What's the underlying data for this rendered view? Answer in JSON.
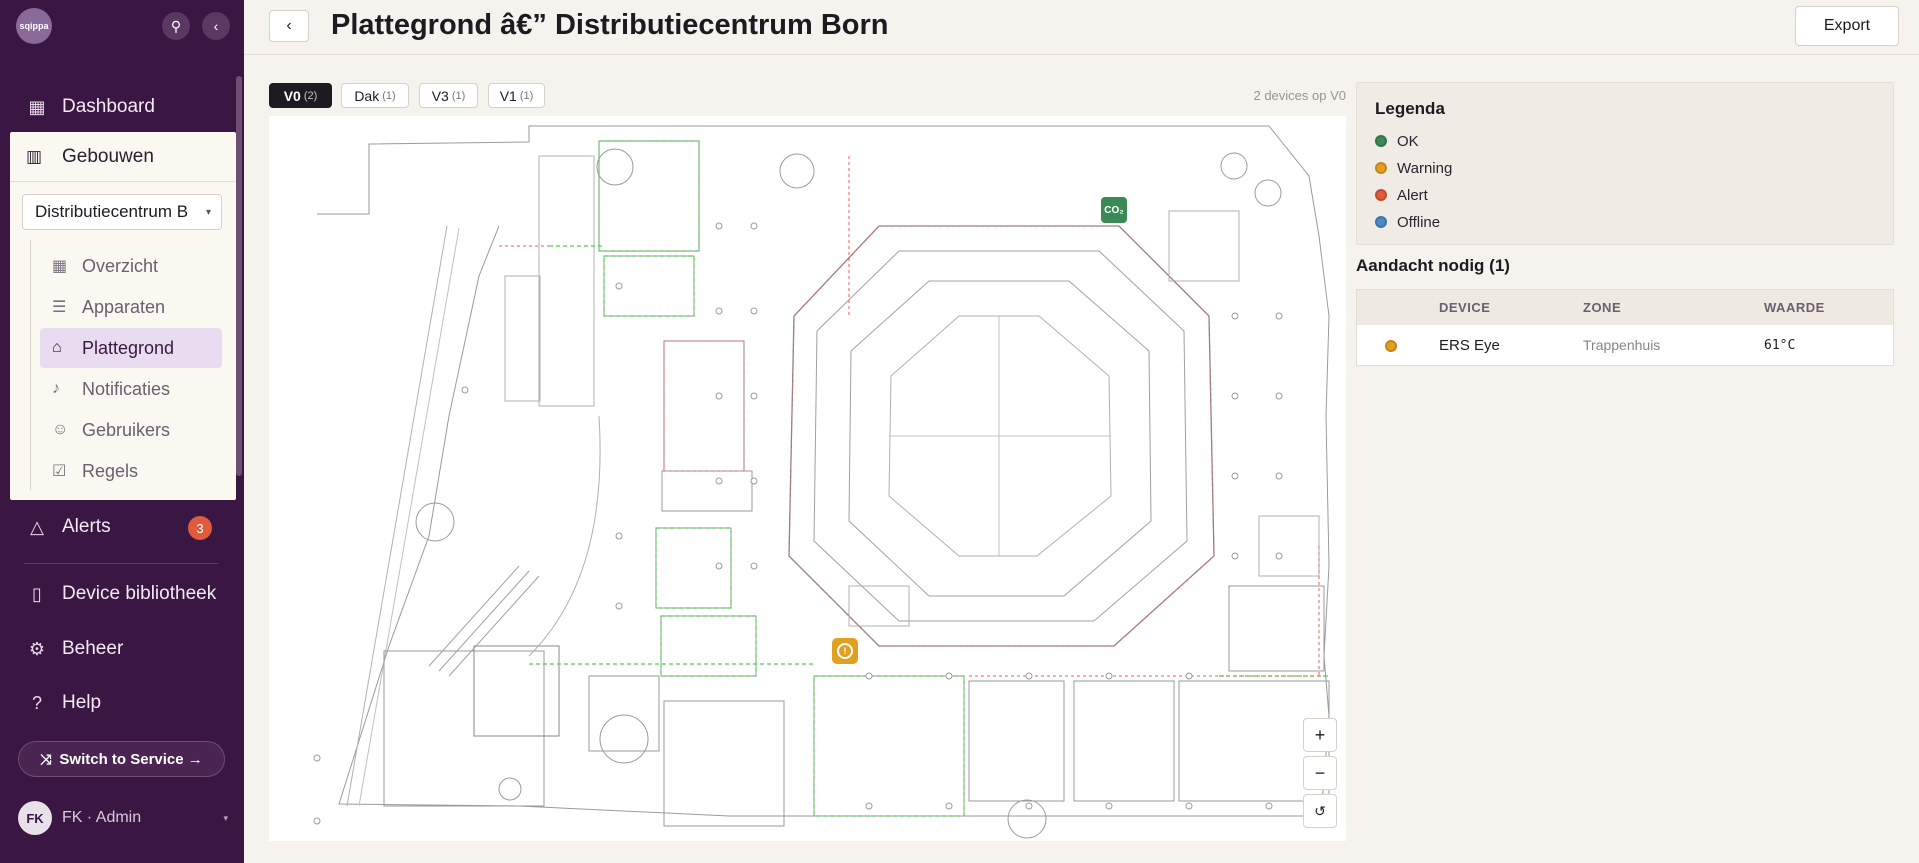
{
  "app": {
    "logo_text": "sqippa"
  },
  "sidebar": {
    "top_buttons": [
      {
        "icon": "pin-icon",
        "glyph": "⚲"
      },
      {
        "icon": "chevron-left-icon",
        "glyph": "‹"
      }
    ],
    "items": [
      {
        "label": "Dashboard",
        "icon": "grid-icon",
        "glyph": "▦"
      },
      {
        "label": "Alerts",
        "icon": "alert-triangle-icon",
        "glyph": "△",
        "badge": "3"
      },
      {
        "label": "Device bibliotheek",
        "icon": "book-icon",
        "glyph": "▯"
      },
      {
        "label": "Beheer",
        "icon": "gear-icon",
        "glyph": "⚙"
      },
      {
        "label": "Help",
        "icon": "help-circle-icon",
        "glyph": "?"
      }
    ],
    "buildings": {
      "label": "Gebouwen",
      "icon": "building-icon",
      "glyph": "▥",
      "selected_building": "Distributiecentrum B",
      "sub_items": [
        {
          "label": "Overzicht",
          "icon": "grid-icon",
          "glyph": "▦"
        },
        {
          "label": "Apparaten",
          "icon": "list-icon",
          "glyph": "☰"
        },
        {
          "label": "Plattegrond",
          "icon": "home-icon",
          "glyph": "⌂",
          "active": true
        },
        {
          "label": "Notificaties",
          "icon": "bell-icon",
          "glyph": "♪"
        },
        {
          "label": "Gebruikers",
          "icon": "users-icon",
          "glyph": "☺"
        },
        {
          "label": "Regels",
          "icon": "check-square-icon",
          "glyph": "☑"
        }
      ]
    },
    "switch_label": "Switch to Service →",
    "user": {
      "initials": "FK",
      "label": "FK · Admin"
    }
  },
  "header": {
    "title": "Plattegrond â€” Distributiecentrum Born",
    "export_label": "Export",
    "back_glyph": "‹"
  },
  "floors": {
    "tabs": [
      {
        "label": "V0",
        "count": "(2)",
        "active": true
      },
      {
        "label": "Dak",
        "count": "(1)"
      },
      {
        "label": "V3",
        "count": "(1)"
      },
      {
        "label": "V1",
        "count": "(1)"
      }
    ],
    "device_count": "2 devices op V0"
  },
  "map": {
    "markers": [
      {
        "type": "co2",
        "label": "CO₂",
        "status_color": "#3a8a55"
      },
      {
        "type": "warning",
        "label": "!",
        "status_color": "#e0a020"
      }
    ],
    "zoom": {
      "in": "+",
      "out": "−",
      "reset": "↺"
    }
  },
  "legend": {
    "title": "Legenda",
    "items": [
      {
        "label": "OK",
        "color": "#3a8a55"
      },
      {
        "label": "Warning",
        "color": "#e0a020"
      },
      {
        "label": "Alert",
        "color": "#e05a3c"
      },
      {
        "label": "Offline",
        "color": "#4a8ac8"
      }
    ]
  },
  "attention": {
    "title": "Aandacht nodig (1)",
    "columns": [
      "DEVICE",
      "ZONE",
      "WAARDE"
    ],
    "rows": [
      {
        "device": "ERS Eye",
        "zone": "Trappenhuis",
        "value": "61°C",
        "status_color": "#e0a020"
      }
    ]
  }
}
